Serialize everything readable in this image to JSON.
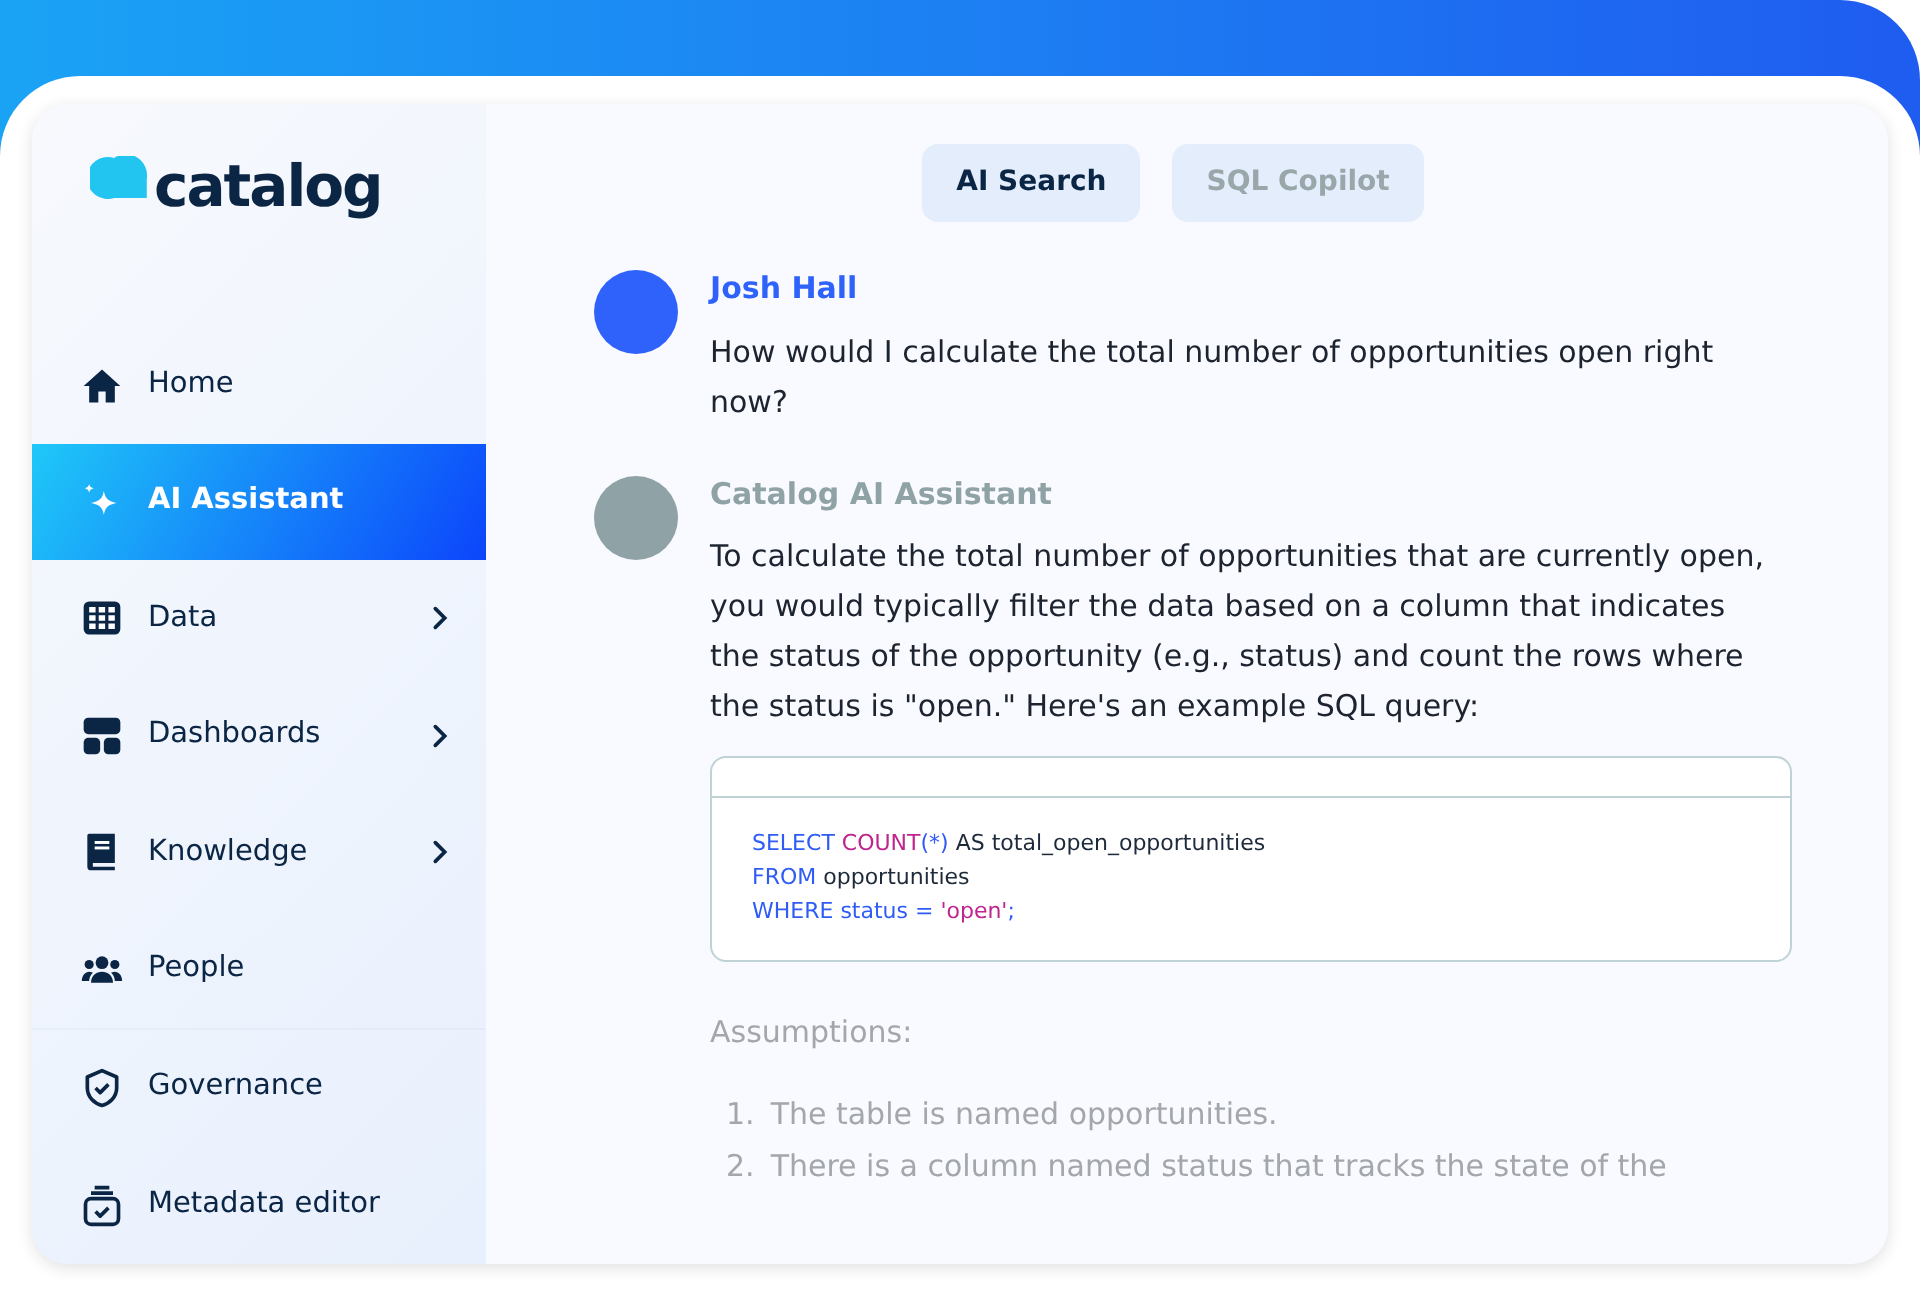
{
  "sidebar": {
    "logo": "catalog",
    "items": [
      {
        "label": "Home",
        "selected": false,
        "submenu": false,
        "divider_before": false
      },
      {
        "label": "AI Assistant",
        "selected": true,
        "submenu": false,
        "divider_before": false
      },
      {
        "label": "Data",
        "selected": false,
        "submenu": true,
        "divider_before": false
      },
      {
        "label": "Dashboards",
        "selected": false,
        "submenu": true,
        "divider_before": false
      },
      {
        "label": "Knowledge",
        "selected": false,
        "submenu": true,
        "divider_before": false
      },
      {
        "label": "People",
        "selected": false,
        "submenu": false,
        "divider_before": false
      },
      {
        "label": "Governance",
        "selected": false,
        "submenu": false,
        "divider_before": true
      },
      {
        "label": "Metadata editor",
        "selected": false,
        "submenu": false,
        "divider_before": false
      }
    ]
  },
  "tabs": [
    {
      "label": "AI Search",
      "selected": true
    },
    {
      "label": "SQL Copilot",
      "selected": false
    }
  ],
  "messages": [
    {
      "kind": "user",
      "author": "Josh Hall",
      "text": "How would I calculate the total number of opportunities open right now?"
    },
    {
      "kind": "assistant",
      "author": "Catalog AI Assistant",
      "text": "To calculate the total number of opportunities that are currently open, you would typically filter the data based on a column that indicates the status of the opportunity (e.g., status) and count the rows where the status is \"open.\" Here's an example SQL query:",
      "code": [
        [
          {
            "kind": "keyword",
            "text": "SELECT "
          },
          {
            "kind": "function",
            "text": "COUNT"
          },
          {
            "kind": "keyword",
            "text": "(*)"
          },
          {
            "kind": "plain",
            "text": " AS total_open_opportunities"
          }
        ],
        [
          {
            "kind": "keyword",
            "text": "FROM "
          },
          {
            "kind": "plain",
            "text": "opportunities"
          }
        ],
        [
          {
            "kind": "keyword",
            "text": "WHERE status = "
          },
          {
            "kind": "string",
            "text": "'open'"
          },
          {
            "kind": "keyword",
            "text": ";"
          }
        ]
      ],
      "assumptions_title": "Assumptions:",
      "assumptions": [
        {
          "marker": "1.",
          "text": "The table is named opportunities."
        },
        {
          "marker": "2.",
          "text": "There is a column named status that tracks the state of the"
        }
      ]
    }
  ]
}
